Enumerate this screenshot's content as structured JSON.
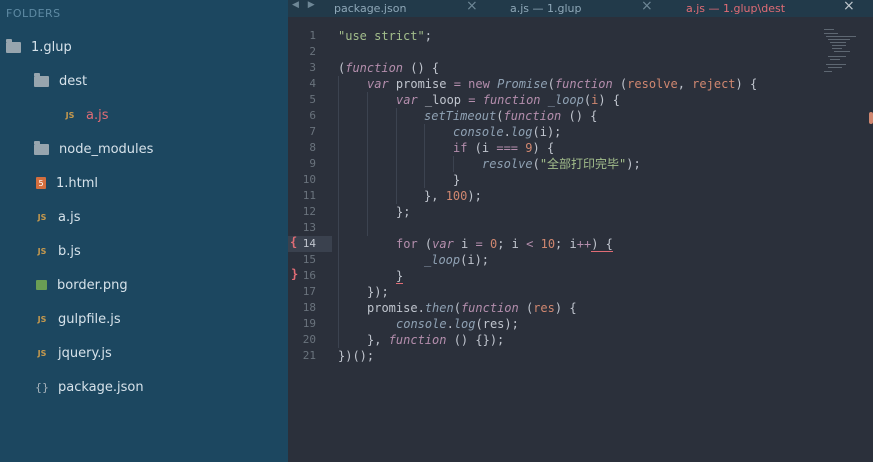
{
  "sidebar": {
    "header": "FOLDERS",
    "items": [
      {
        "label": "1.glup",
        "icon": "folder-open-icon"
      },
      {
        "label": "dest",
        "icon": "folder-open-icon"
      },
      {
        "label": "a.js",
        "icon": "js-file-icon",
        "badge": "JS"
      },
      {
        "label": "node_modules",
        "icon": "folder-icon"
      },
      {
        "label": "1.html",
        "icon": "html-file-icon",
        "badge": "5"
      },
      {
        "label": "a.js",
        "icon": "js-file-icon",
        "badge": "JS"
      },
      {
        "label": "b.js",
        "icon": "js-file-icon",
        "badge": "JS"
      },
      {
        "label": "border.png",
        "icon": "image-file-icon"
      },
      {
        "label": "gulpfile.js",
        "icon": "js-file-icon",
        "badge": "JS"
      },
      {
        "label": "jquery.js",
        "icon": "js-file-icon",
        "badge": "JS"
      },
      {
        "label": "package.json",
        "icon": "json-file-icon",
        "badge": "{}"
      }
    ]
  },
  "tabs": [
    {
      "label": "package.json",
      "close": "×"
    },
    {
      "label": "a.js — 1.glup",
      "close": "×"
    },
    {
      "label": "a.js — 1.glup\\dest",
      "close": "×",
      "active": true
    }
  ],
  "nav": {
    "prev": "◀",
    "next": "▶"
  },
  "editor": {
    "current_line": "14",
    "line_numbers": [
      "1",
      "2",
      "3",
      "4",
      "5",
      "6",
      "7",
      "8",
      "9",
      "10",
      "11",
      "12",
      "13",
      "14",
      "15",
      "16",
      "17",
      "18",
      "19",
      "20",
      "21"
    ],
    "bracket_marks": {
      "open": "{",
      "close": "}"
    },
    "code": {
      "l1_str": "\"use strict\"",
      "l1_semi": ";",
      "l3_open": "(",
      "l3_kw": "function",
      "l3_rest": " () {",
      "l4_var": "var",
      "l4_name": " promise ",
      "l4_eq": "=",
      "l4_new": " new ",
      "l4_promise": "Promise",
      "l4_p1": "(",
      "l4_fn": "function",
      "l4_p2": " (",
      "l4_resolve": "resolve",
      "l4_comma": ", ",
      "l4_reject": "reject",
      "l4_end": ") {",
      "l5_var": "var",
      "l5_name": " _loop ",
      "l5_eq": "=",
      "l5_fn": " function",
      "l5_fname": " _loop",
      "l5_p1": "(",
      "l5_i": "i",
      "l5_end": ") {",
      "l6_set": "setTimeout",
      "l6_p1": "(",
      "l6_fn": "function",
      "l6_end": " () {",
      "l7_console": "console",
      "l7_dot": ".",
      "l7_log": "log",
      "l7_end": "(i);",
      "l8_if": "if",
      "l8_p1": " (i ",
      "l8_eq": "===",
      "l8_sp": " ",
      "l8_num": "9",
      "l8_end": ") {",
      "l9_resolve": "resolve",
      "l9_p1": "(",
      "l9_str": "\"全部打印完毕\"",
      "l9_end": ");",
      "l10": "}",
      "l11_a": "}, ",
      "l11_num": "100",
      "l11_b": ");",
      "l12": "};",
      "l14_for": "for",
      "l14_p1": " (",
      "l14_var": "var",
      "l14_i": " i ",
      "l14_eq": "=",
      "l14_sp": " ",
      "l14_zero": "0",
      "l14_mid": "; i ",
      "l14_lt": "<",
      "l14_sp2": " ",
      "l14_ten": "10",
      "l14_mid2": "; i",
      "l14_inc": "++",
      "l14_end": ") {",
      "l15_loop": "_loop",
      "l15_end": "(i);",
      "l16": "}",
      "l17": "});",
      "l18_promise": "promise",
      "l18_dot": ".",
      "l18_then": "then",
      "l18_p1": "(",
      "l18_fn": "function",
      "l18_p2": " (",
      "l18_res": "res",
      "l18_end": ") {",
      "l19_console": "console",
      "l19_dot": ".",
      "l19_log": "log",
      "l19_end": "(res);",
      "l20_a": "}, ",
      "l20_fn": "function",
      "l20_end": " () {});",
      "l21": "})();"
    }
  },
  "colors": {
    "sidebar_bg": "#1c4760",
    "editor_bg": "#2b303b",
    "tab_active": "#e06c75",
    "keyword": "#b48ead",
    "string": "#a3be8c",
    "number": "#d08770",
    "function": "#8fa1b3"
  }
}
